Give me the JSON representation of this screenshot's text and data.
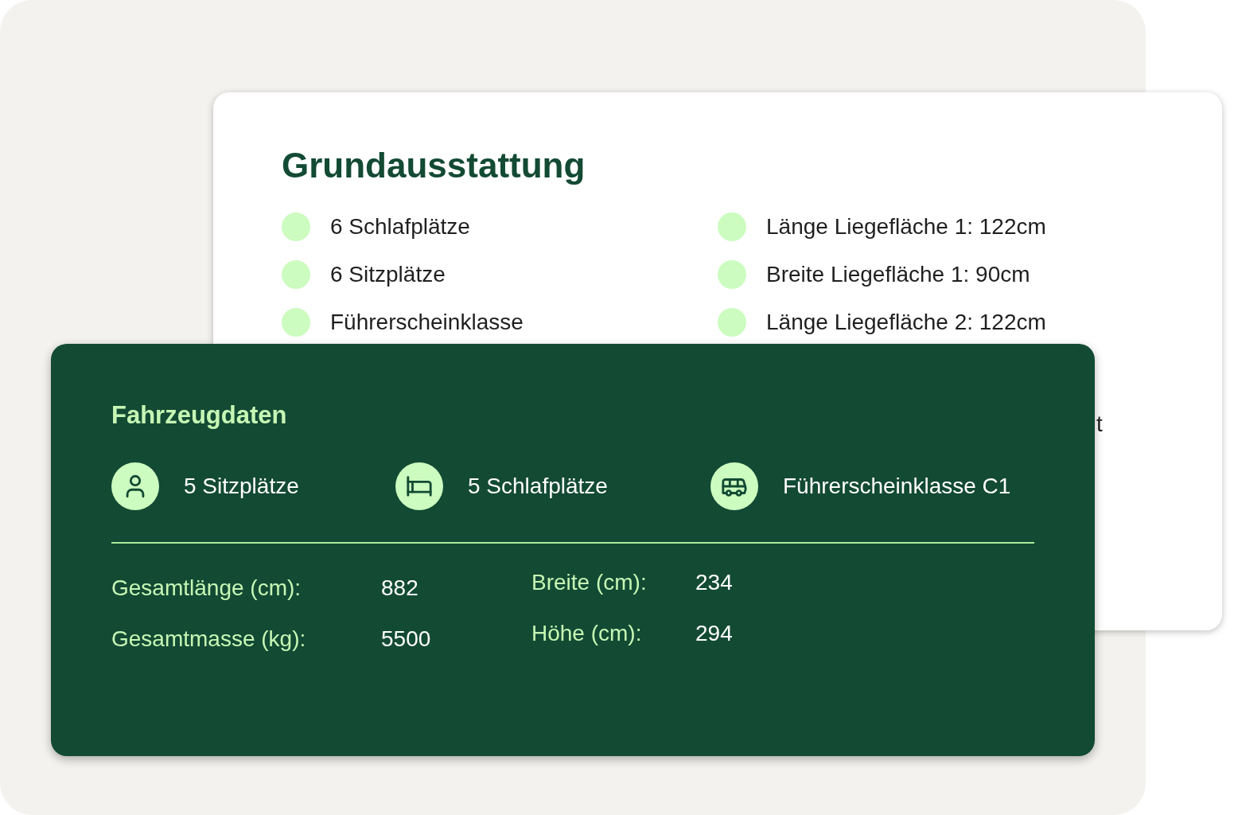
{
  "equipment_card": {
    "title": "Grundausstattung",
    "left_items": [
      "6 Schlafplätze",
      "6 Sitzplätze",
      "Führerscheinklasse"
    ],
    "right_items": [
      "Länge Liegefläche 1: 122cm",
      "Breite Liegefläche 1: 90cm",
      "Länge Liegefläche 2: 122cm"
    ],
    "hidden_text_fragment": "t"
  },
  "vehicle_card": {
    "title": "Fahrzeugdaten",
    "features": [
      {
        "kind": "person",
        "label": "5 Sitzplätze"
      },
      {
        "kind": "bed",
        "label": "5 Schlafplätze"
      },
      {
        "kind": "bus",
        "label": "Führerscheinklasse C1"
      }
    ],
    "specs_left": [
      {
        "label": "Gesamtlänge (cm):",
        "value": "882"
      },
      {
        "label": "Gesamtmasse (kg):",
        "value": "5500"
      }
    ],
    "specs_right": [
      {
        "label": "Breite (cm):",
        "value": "234"
      },
      {
        "label": "Höhe (cm):",
        "value": "294"
      }
    ]
  }
}
